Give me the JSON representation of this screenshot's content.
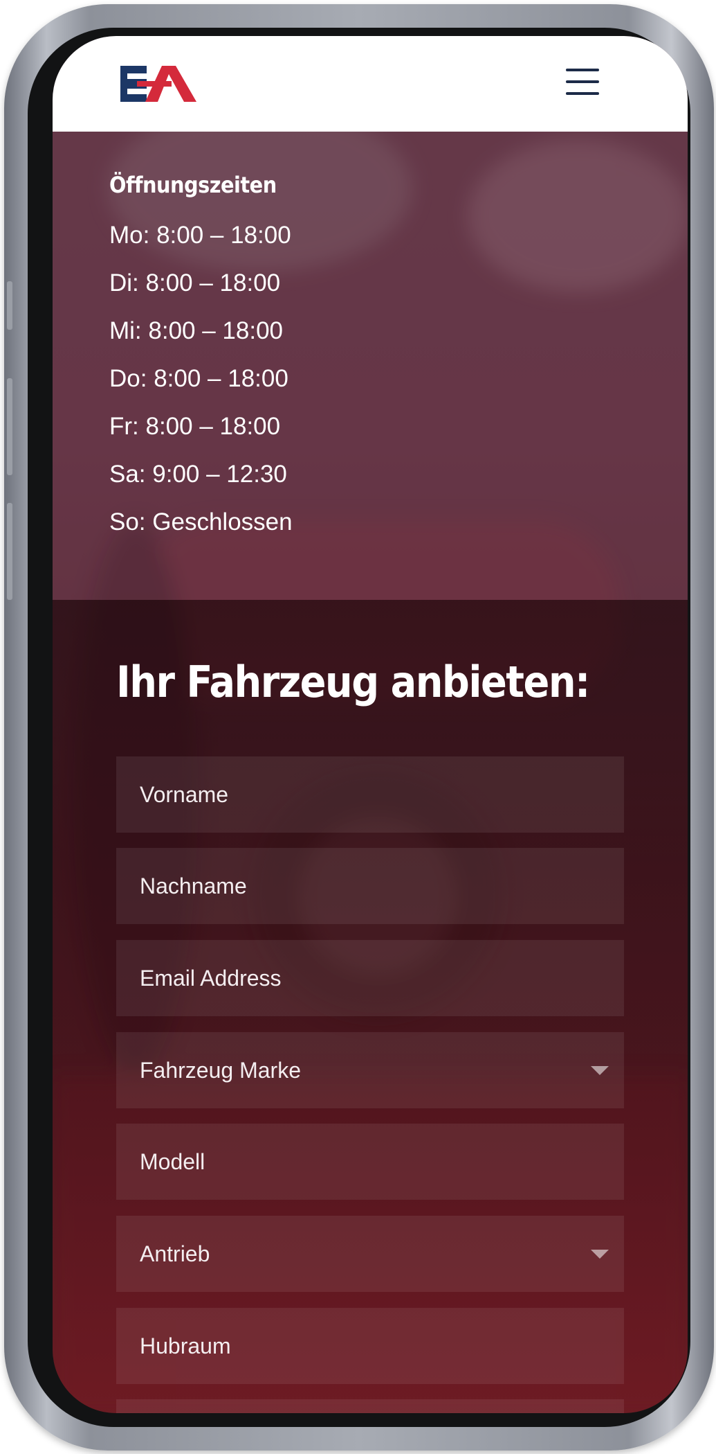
{
  "brand": {
    "logo_text": "EA",
    "colors": {
      "navy": "#1c3766",
      "red": "#d42a3b",
      "hamburger": "#1c2b48"
    }
  },
  "header": {
    "menu_icon": "hamburger-menu-icon"
  },
  "hours": {
    "title": "Öffnungszeiten",
    "items": [
      "Mo: 8:00 – 18:00",
      "Di: 8:00 – 18:00",
      "Mi: 8:00 – 18:00",
      "Do: 8:00 – 18:00",
      "Fr: 8:00 – 18:00",
      "Sa: 9:00 – 12:30",
      "So: Geschlossen"
    ]
  },
  "form": {
    "title": "Ihr Fahrzeug anbieten:",
    "fields": [
      {
        "label": "Vorname",
        "kind": "text"
      },
      {
        "label": "Nachname",
        "kind": "text"
      },
      {
        "label": "Email Address",
        "kind": "email"
      },
      {
        "label": "Fahrzeug Marke",
        "kind": "select"
      },
      {
        "label": "Modell",
        "kind": "text"
      },
      {
        "label": "Antrieb",
        "kind": "select"
      },
      {
        "label": "Hubraum",
        "kind": "text"
      }
    ]
  }
}
